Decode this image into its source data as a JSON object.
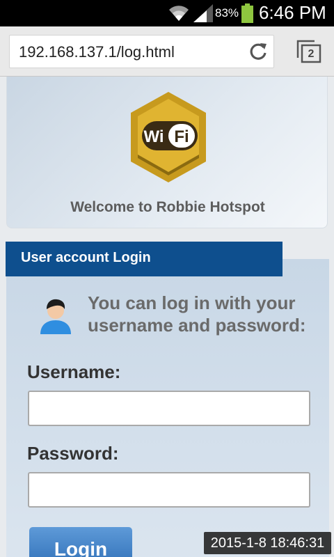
{
  "status_bar": {
    "battery_percent": "83%",
    "time": "6:46 PM",
    "icons": [
      "wifi-icon",
      "signal-icon",
      "battery-icon"
    ],
    "battery_color": "#8ec63f"
  },
  "browser": {
    "url": "192.168.137.1/log.html",
    "tab_count": "2",
    "icons": [
      "reload-icon",
      "tabs-icon"
    ]
  },
  "welcome": {
    "logo_text_wi": "Wi",
    "logo_text_fi": "Fi",
    "title": "Welcome to Robbie Hotspot"
  },
  "login": {
    "header": "User account Login",
    "intro": "You can log in with  your username  and password:",
    "username_label": "Username:",
    "username_value": "",
    "password_label": "Password:",
    "password_value": "",
    "button_label": "Login",
    "accent_color": "#0e4f8e"
  },
  "overlay": {
    "timestamp": "2015-1-8 18:46:31"
  }
}
